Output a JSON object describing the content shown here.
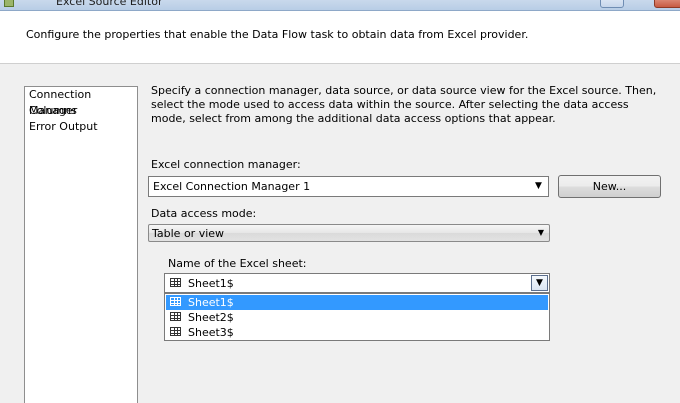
{
  "window": {
    "title": "Excel Source Editor"
  },
  "header": {
    "description": "Configure the properties that enable the Data Flow task to obtain data from Excel provider."
  },
  "nav": {
    "items": [
      {
        "label": "Connection Manager"
      },
      {
        "label": "Columns"
      },
      {
        "label": "Error Output"
      }
    ]
  },
  "main": {
    "intro": "Specify a connection manager, data source, or data source view for the Excel source. Then, select the mode used to access data within the source. After selecting the data access mode, select from among the additional data access options that appear.",
    "connection_label": "Excel connection manager:",
    "connection_value": "Excel Connection Manager 1",
    "new_button": "New...",
    "access_mode_label": "Data access mode:",
    "access_mode_value": "Table or view",
    "sheet_label": "Name of the Excel sheet:",
    "sheet_value": "Sheet1$",
    "sheet_options": [
      "Sheet1$",
      "Sheet2$",
      "Sheet3$"
    ],
    "highlighted_option": "Sheet1$"
  },
  "colors": {
    "highlight": "#3399ff",
    "panel_background": "#f0f0f0",
    "header_background": "#ffffff"
  },
  "icons": {
    "sheet": "table-grid-icon",
    "dropdown": "chevron-down-icon"
  }
}
